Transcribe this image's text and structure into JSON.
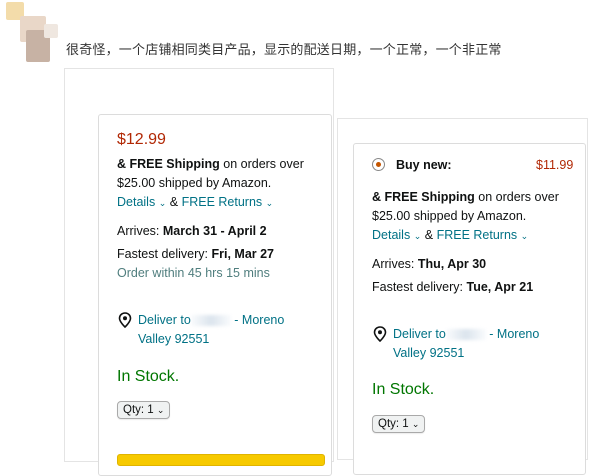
{
  "post": {
    "text": "很奇怪，一个店铺相同类目产品，显示的配送日期，一个正常，一个非正常"
  },
  "colors": {
    "price": "#b12704",
    "link": "#007185",
    "in_stock": "#007600",
    "radio_accent": "#c45500"
  },
  "left_offer": {
    "price": "$12.99",
    "free_shipping_bold": "& FREE Shipping",
    "free_shipping_rest": " on orders over",
    "shipped_by": "$25.00 shipped by Amazon.",
    "details_label": "Details",
    "amp": "&",
    "free_returns_label": "FREE Returns",
    "arrives_label": "Arrives: ",
    "arrives_value": "March 31 - April 2",
    "fastest_label": "Fastest delivery: ",
    "fastest_value": "Fri, Mar 27",
    "order_within": "Order within 45 hrs 15 mins",
    "deliver_to": "Deliver to",
    "deliver_city": "- Moreno",
    "deliver_city2": "Valley 92551",
    "stock": "In Stock.",
    "qty": "Qty: 1"
  },
  "right_offer": {
    "buy_new_label": "Buy new:",
    "price": "$11.99",
    "free_shipping_bold": "& FREE Shipping",
    "free_shipping_rest": " on orders over",
    "shipped_by": "$25.00 shipped by Amazon.",
    "details_label": "Details",
    "amp": "&",
    "free_returns_label": "FREE Returns",
    "arrives_label": "Arrives: ",
    "arrives_value": "Thu, Apr 30",
    "fastest_label": "Fastest delivery: ",
    "fastest_value": "Tue, Apr 21",
    "deliver_to": "Deliver to",
    "deliver_city": "- Moreno",
    "deliver_city2": "Valley 92551",
    "stock": "In Stock.",
    "qty": "Qty: 1"
  },
  "icons": {
    "location": "location-pin-icon",
    "chevron": "chevron-down-icon",
    "radio": "radio-selected-icon"
  }
}
